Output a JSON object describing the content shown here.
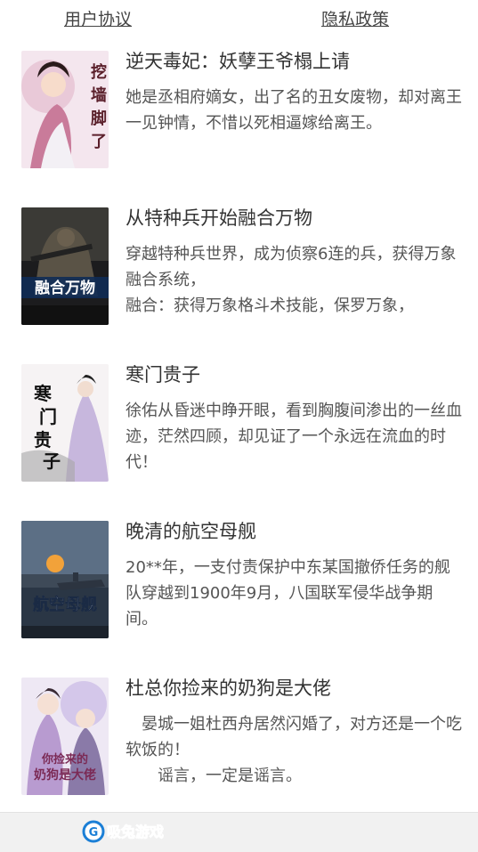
{
  "books": [
    {
      "title": "逆天毒妃：妖孽王爷榻上请",
      "description": "她是丞相府嫡女，出了名的丑女废物，却对离王一见钟情，不惜以死相逼嫁给离王。",
      "cover_text": "挖墙脚了"
    },
    {
      "title": "从特种兵开始融合万物",
      "description": "穿越特种兵世界，成为侦察6连的兵，获得万象融合系统，\n融合：获得万象格斗术技能，保罗万象，",
      "cover_text": "融合万物"
    },
    {
      "title": "寒门贵子",
      "description": "徐佑从昏迷中睁开眼，看到胸腹间渗出的一丝血迹，茫然四顾，却见证了一个永远在流血的时代！",
      "cover_text": "寒门贵子"
    },
    {
      "title": "晚清的航空母舰",
      "description": "20**年，一支付责保护中东某国撤侨任务的舰队穿越到1900年9月，八国联军侵华战争期间。",
      "cover_text": "航空母舰"
    },
    {
      "title": "杜总你捡来的奶狗是大佬",
      "description": "　晏城一姐杜西舟居然闪婚了，对方还是一个吃软饭的！\n　　谣言，一定是谣言。",
      "cover_text": "你捡来的奶狗是大佬"
    }
  ],
  "footer": {
    "user_agreement": "用户协议",
    "privacy_policy": "隐私政策",
    "watermark": "G 吸兔游戏"
  },
  "colors": {
    "title": "#333333",
    "description": "#555555",
    "footer_bg": "#f1f1f1"
  }
}
